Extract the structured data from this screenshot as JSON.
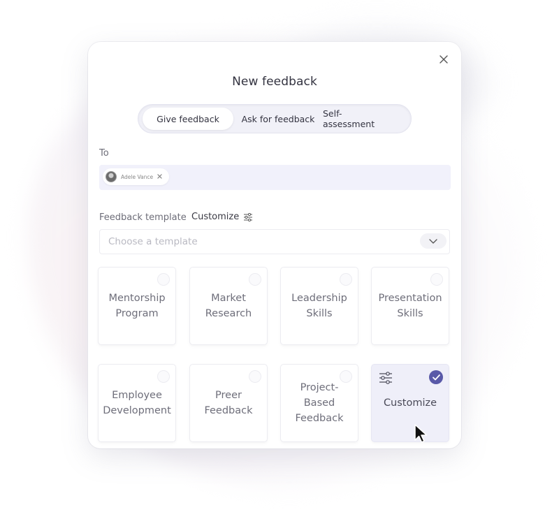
{
  "dialog": {
    "title": "New feedback",
    "close_icon": "close-icon"
  },
  "tabs": [
    {
      "label": "Give feedback",
      "active": true
    },
    {
      "label": "Ask for feedback",
      "active": false
    },
    {
      "label": "Self- assessment",
      "active": false
    }
  ],
  "to": {
    "label": "To",
    "recipients": [
      {
        "name": "Adele Vance"
      }
    ]
  },
  "template": {
    "label": "Feedback template",
    "customize_label": "Customize",
    "placeholder": "Choose a template"
  },
  "cards": [
    {
      "label": "Mentorship\nProgram",
      "selected": false
    },
    {
      "label": "Market\nResearch",
      "selected": false
    },
    {
      "label": "Leadership\nSkills",
      "selected": false
    },
    {
      "label": "Presentation\nSkills",
      "selected": false
    },
    {
      "label": "Employee\nDevelopment",
      "selected": false
    },
    {
      "label": "Preer\nFeedback",
      "selected": false
    },
    {
      "label": "Project-Based\nFeedback",
      "selected": false
    },
    {
      "label": "Customize",
      "selected": true
    }
  ],
  "colors": {
    "accent": "#5959a8",
    "selected_card_bg": "#efeff9",
    "input_bg": "#f1f1fb"
  }
}
